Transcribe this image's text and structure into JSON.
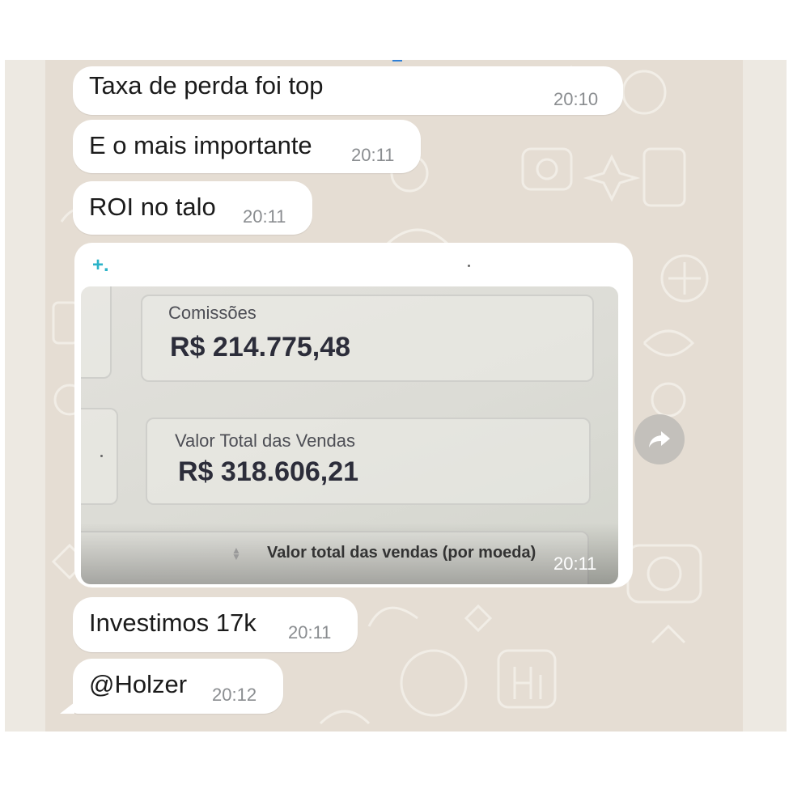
{
  "messages": [
    {
      "text": "Taxa de perda foi top",
      "time": "20:10"
    },
    {
      "text": "E o mais importante",
      "time": "20:11"
    },
    {
      "text": "ROI no talo",
      "time": "20:11"
    },
    {
      "text": "Investimos 17k",
      "time": "20:11"
    },
    {
      "text": "@Holzer",
      "time": "20:12"
    }
  ],
  "image_message": {
    "plus_mark": "+.",
    "time": "20:11",
    "photo": {
      "commissions_label": "Comissões",
      "commissions_value": "R$ 214.775,48",
      "sales_label": "Valor Total das Vendas",
      "sales_value": "R$ 318.606,21",
      "footer_label": "Valor total das vendas (por moeda)"
    }
  },
  "icons": {
    "forward": "forward-share-icon",
    "sort": "sort-arrows-icon"
  },
  "colors": {
    "wallpaper": "#e5ddd3",
    "bubble": "#ffffff",
    "mention": "#2b86d8",
    "timestamp": "#8a8d90",
    "forward_button": "#c3c0bb"
  }
}
